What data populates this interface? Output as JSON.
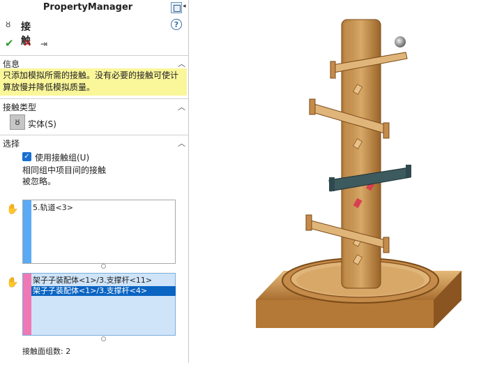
{
  "panel": {
    "title": "PropertyManager",
    "feature_title": "接触",
    "icons": {
      "feature": "contact-icon",
      "help": "help-icon",
      "ok": "check-icon",
      "cancel": "close-icon",
      "pin": "pushpin-icon"
    },
    "colors": {
      "ok": "#2f9a2f",
      "cancel": "#d02020",
      "info_bg": "#faf69a",
      "stripe_a": "#5aaaf5",
      "stripe_b": "#f078b4",
      "selected": "#0a64c2",
      "list_b_bg": "#cfe4f8"
    }
  },
  "info": {
    "header": "信息",
    "text": "只添加模拟所需的接触。没有必要的接触可使计算放慢并降低模拟质量。"
  },
  "contact_type": {
    "header": "接触类型",
    "option": "实体(S)"
  },
  "selection": {
    "header": "选择",
    "use_group_label": "使用接触组(U)",
    "note": "相同组中项目间的接触被忽略。",
    "list_a": [
      "5.轨道<3>"
    ],
    "list_b": [
      "架子子装配体<1>/3.支撑杆<11>",
      "架子子装配体<1>/3.支撑杆<4>"
    ],
    "count_label": "接触面组数: 2"
  },
  "viewport": {
    "model": "marble-run-assembly"
  }
}
